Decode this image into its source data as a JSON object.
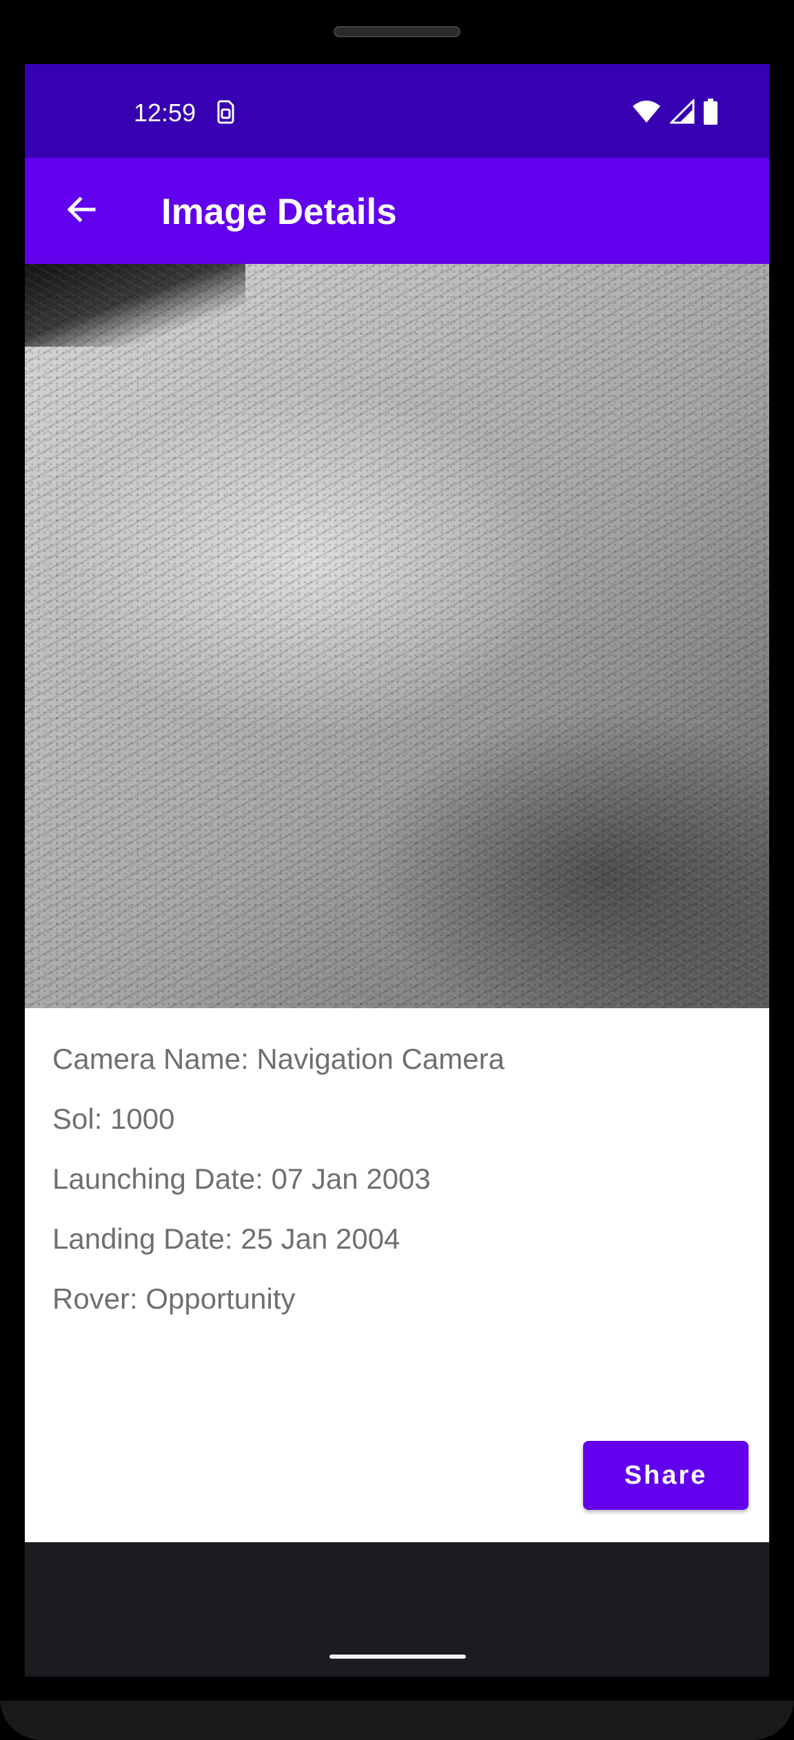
{
  "status_bar": {
    "time": "12:59",
    "left_icon": "sim-card-icon",
    "right_icons": [
      "wifi-icon",
      "signal-icon",
      "battery-icon"
    ]
  },
  "app_bar": {
    "title": "Image Details",
    "back_icon": "arrow-back-icon",
    "color": "#6200ee"
  },
  "photo": {
    "description_icon": "mars-terrain-photo"
  },
  "details": {
    "camera_name": "Camera Name: Navigation Camera",
    "sol": "Sol: 1000",
    "launching_date": "Launching Date: 07 Jan 2003",
    "landing_date": "Landing Date: 25 Jan 2004",
    "rover": "Rover: Opportunity"
  },
  "actions": {
    "share_label": "Share"
  },
  "colors": {
    "status_bar": "#3700b3",
    "primary": "#6200ee",
    "text_secondary": "#6f6f6f",
    "nav_bar": "#1b1b21"
  }
}
